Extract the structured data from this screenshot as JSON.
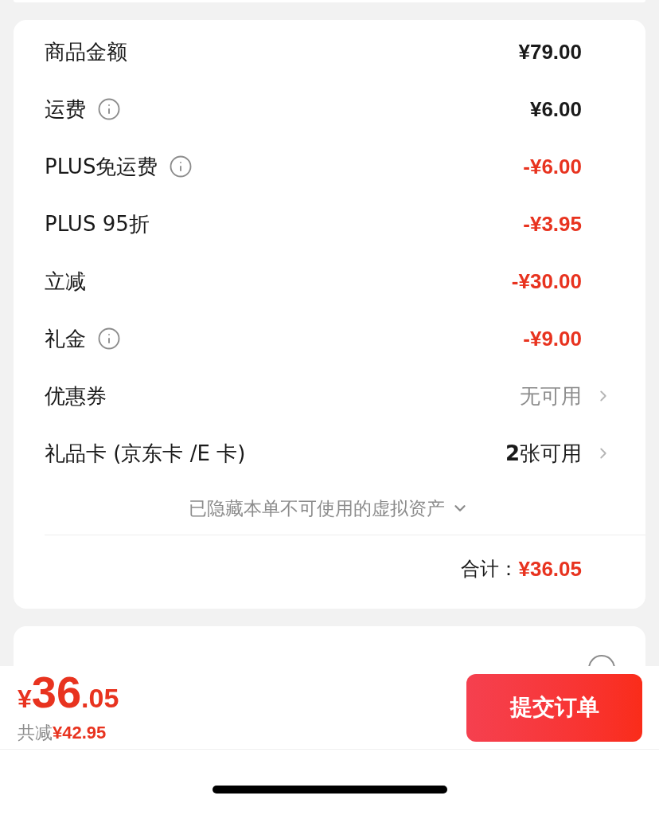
{
  "rows": [
    {
      "label": "商品金额",
      "info": false,
      "kind": "amount",
      "value": "¥79.00"
    },
    {
      "label": "运费",
      "info": true,
      "kind": "amount",
      "value": "¥6.00"
    },
    {
      "label": "PLUS免运费",
      "info": true,
      "kind": "discount",
      "value": "-¥6.00"
    },
    {
      "label": "PLUS 95折",
      "info": false,
      "kind": "discount",
      "value": "-¥3.95"
    },
    {
      "label": "立减",
      "info": false,
      "kind": "discount",
      "value": "-¥30.00"
    },
    {
      "label": "礼金",
      "info": true,
      "kind": "discount",
      "value": "-¥9.00"
    },
    {
      "label": "优惠券",
      "info": false,
      "kind": "link",
      "muted": true,
      "value": "无可用"
    },
    {
      "label": "礼品卡 (京东卡 /E 卡)",
      "info": false,
      "kind": "link",
      "muted": false,
      "value": "**2**张可用"
    }
  ],
  "hidden_note": "已隐藏本单不可使用的虚拟资产",
  "total": {
    "label": "合计：",
    "value": "¥36.05"
  },
  "footer": {
    "currency": "¥",
    "price_integer": "36",
    "price_decimal": ".05",
    "saved_label": "共减",
    "saved_value": "¥42.95",
    "submit": "提交订单"
  }
}
